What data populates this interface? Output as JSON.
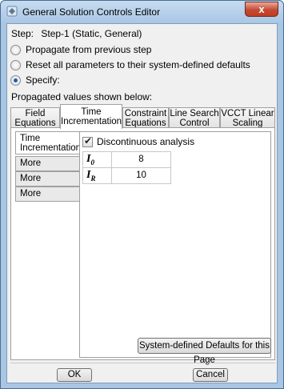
{
  "window": {
    "title": "General Solution Controls Editor",
    "close_label": "x"
  },
  "step": {
    "label": "Step:",
    "value": "Step-1 (Static, General)"
  },
  "options": [
    {
      "label": "Propagate from previous step",
      "selected": false
    },
    {
      "label": "Reset all parameters to their system-defined defaults",
      "selected": false
    },
    {
      "label": "Specify:",
      "selected": true
    }
  ],
  "propagated_label": "Propagated values shown below:",
  "tabs": [
    {
      "line1": "Field",
      "line2": "Equations"
    },
    {
      "line1": "Time",
      "line2": "Incrementation"
    },
    {
      "line1": "Constraint",
      "line2": "Equations"
    },
    {
      "line1": "Line Search",
      "line2": "Control"
    },
    {
      "line1": "VCCT Linear",
      "line2": "Scaling"
    }
  ],
  "subtabs": [
    {
      "line1": "Time",
      "line2": "Incrementation"
    },
    {
      "line1": "More"
    },
    {
      "line1": "More"
    },
    {
      "line1": "More"
    }
  ],
  "content": {
    "discontinuous_label": "Discontinuous analysis",
    "discontinuous_checked": true,
    "params": [
      {
        "symbol": "I",
        "sub": "0",
        "value": "8"
      },
      {
        "symbol": "I",
        "sub": "R",
        "value": "10"
      }
    ],
    "defaults_button": "System-defined Defaults for this Page"
  },
  "buttons": {
    "ok": "OK",
    "cancel": "Cancel"
  }
}
